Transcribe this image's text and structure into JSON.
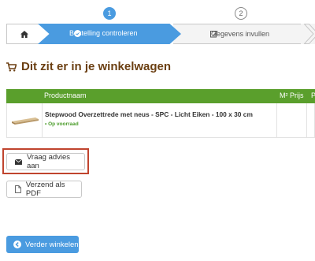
{
  "steps": {
    "step1_number": "1",
    "step2_number": "2",
    "step1_label": "Bestelling controleren",
    "step2_label": "Gegevens invullen",
    "icons": {
      "home": "home-icon",
      "step1": "check-circle-icon",
      "step2": "edit-icon"
    }
  },
  "colors": {
    "accent": "#4a9be0",
    "table_header": "#5a9f2c",
    "heading": "#6b3f12",
    "highlight": "#c0442e"
  },
  "page": {
    "heading": "Dit zit er in je winkelwagen",
    "heading_icon": "cart-icon"
  },
  "table": {
    "headers": {
      "name": "Productnaam",
      "price": "M² Prijs",
      "more": "P"
    },
    "rows": [
      {
        "name": "Stepwood Overzettrede met neus - SPC - Licht Eiken - 100 x 30 cm",
        "stock": "Op voorraad",
        "thumb": "product-thumbnail"
      }
    ]
  },
  "buttons": {
    "advice": "Vraag advies aan",
    "advice_icon": "envelope-icon",
    "pdf": "Verzend als PDF",
    "pdf_icon": "file-icon",
    "continue": "Verder winkelen",
    "continue_icon": "arrow-left-circle-icon"
  }
}
